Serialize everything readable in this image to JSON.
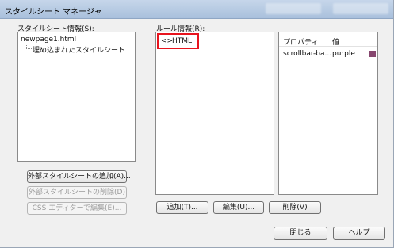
{
  "window": {
    "title": "スタイルシート マネージャ"
  },
  "stylesheets": {
    "label": "スタイルシート情報(S):",
    "items": [
      {
        "label": "newpage1.html"
      },
      {
        "label": "埋め込まれたスタイルシート"
      }
    ],
    "buttons": {
      "add": "外部スタイルシートの追加(A)...",
      "remove": "外部スタイルシートの削除(D)",
      "edit_css": "CSS エディターで編集(E)..."
    }
  },
  "rules": {
    "label": "ルール情報(R):",
    "items": [
      {
        "icon": "tag-icon",
        "glyph": "<>",
        "label": "HTML"
      }
    ],
    "buttons": {
      "add": "追加(T)...",
      "edit": "編集(U)...",
      "delete": "削除(V)"
    }
  },
  "properties": {
    "columns": [
      "プロパティ",
      "値"
    ],
    "rows": [
      {
        "property": "scrollbar-ba...",
        "value": "purple",
        "swatch": "#86466e"
      }
    ]
  },
  "footer": {
    "close": "閉じる",
    "help": "ヘルプ"
  },
  "colors": {
    "highlight": "#e8141e"
  }
}
